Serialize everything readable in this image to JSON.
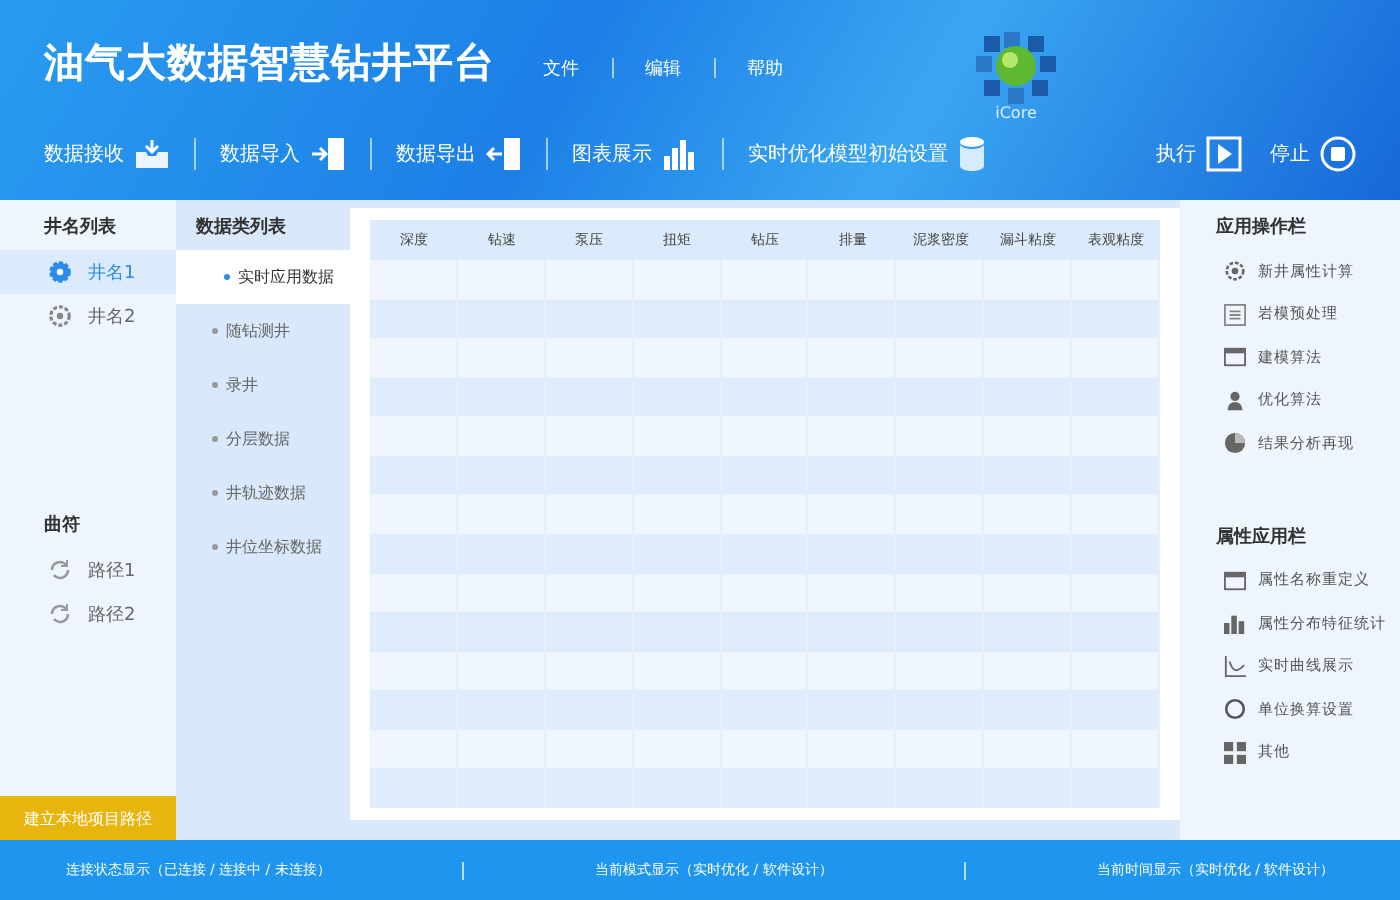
{
  "header": {
    "title": "油气大数据智慧钻井平台",
    "menu": [
      "文件",
      "编辑",
      "帮助"
    ],
    "logo_text": "iCore"
  },
  "toolbar": [
    {
      "label": "数据接收",
      "kind": "receive"
    },
    {
      "label": "数据导入",
      "kind": "import"
    },
    {
      "label": "数据导出",
      "kind": "export"
    },
    {
      "label": "图表展示",
      "kind": "chart"
    },
    {
      "label": "实时优化模型初始设置",
      "kind": "database"
    }
  ],
  "run_controls": [
    {
      "label": "执行",
      "kind": "play"
    },
    {
      "label": "停止",
      "kind": "stop"
    }
  ],
  "well_list": {
    "title": "井名列表",
    "items": [
      {
        "label": "井名1",
        "selected": true
      },
      {
        "label": "井名2",
        "selected": false
      }
    ]
  },
  "path_list": {
    "title": "曲符",
    "items": [
      "路径1",
      "路径2"
    ]
  },
  "create_path_button": "建立本地项目路径",
  "data_categories": {
    "title": "数据类列表",
    "items": [
      {
        "label": "实时应用数据",
        "selected": true
      },
      {
        "label": "随钻测井",
        "selected": false
      },
      {
        "label": "录井",
        "selected": false
      },
      {
        "label": "分层数据",
        "selected": false
      },
      {
        "label": "井轨迹数据",
        "selected": false
      },
      {
        "label": "井位坐标数据",
        "selected": false
      }
    ]
  },
  "table": {
    "columns": [
      "深度",
      "钻速",
      "泵压",
      "扭矩",
      "钻压",
      "排量",
      "泥浆密度",
      "漏斗粘度",
      "表观粘度"
    ]
  },
  "app_operations": {
    "title": "应用操作栏",
    "items": [
      {
        "label": "新井属性计算",
        "kind": "gear"
      },
      {
        "label": "岩模预处理",
        "kind": "list"
      },
      {
        "label": "建模算法",
        "kind": "window"
      },
      {
        "label": "优化算法",
        "kind": "person"
      },
      {
        "label": "结果分析再现",
        "kind": "pie"
      }
    ]
  },
  "property_apps": {
    "title": "属性应用栏",
    "items": [
      {
        "label": "属性名称重定义",
        "kind": "window"
      },
      {
        "label": "属性分布特征统计",
        "kind": "bars"
      },
      {
        "label": "实时曲线展示",
        "kind": "curve"
      },
      {
        "label": "单位换算设置",
        "kind": "circle"
      },
      {
        "label": "其他",
        "kind": "grid"
      }
    ]
  },
  "status_bar": [
    "连接状态显示（已连接 / 连接中 / 未连接）",
    "当前模式显示（实时优化 / 软件设计）",
    "当前时间显示（实时优化 / 软件设计）"
  ]
}
